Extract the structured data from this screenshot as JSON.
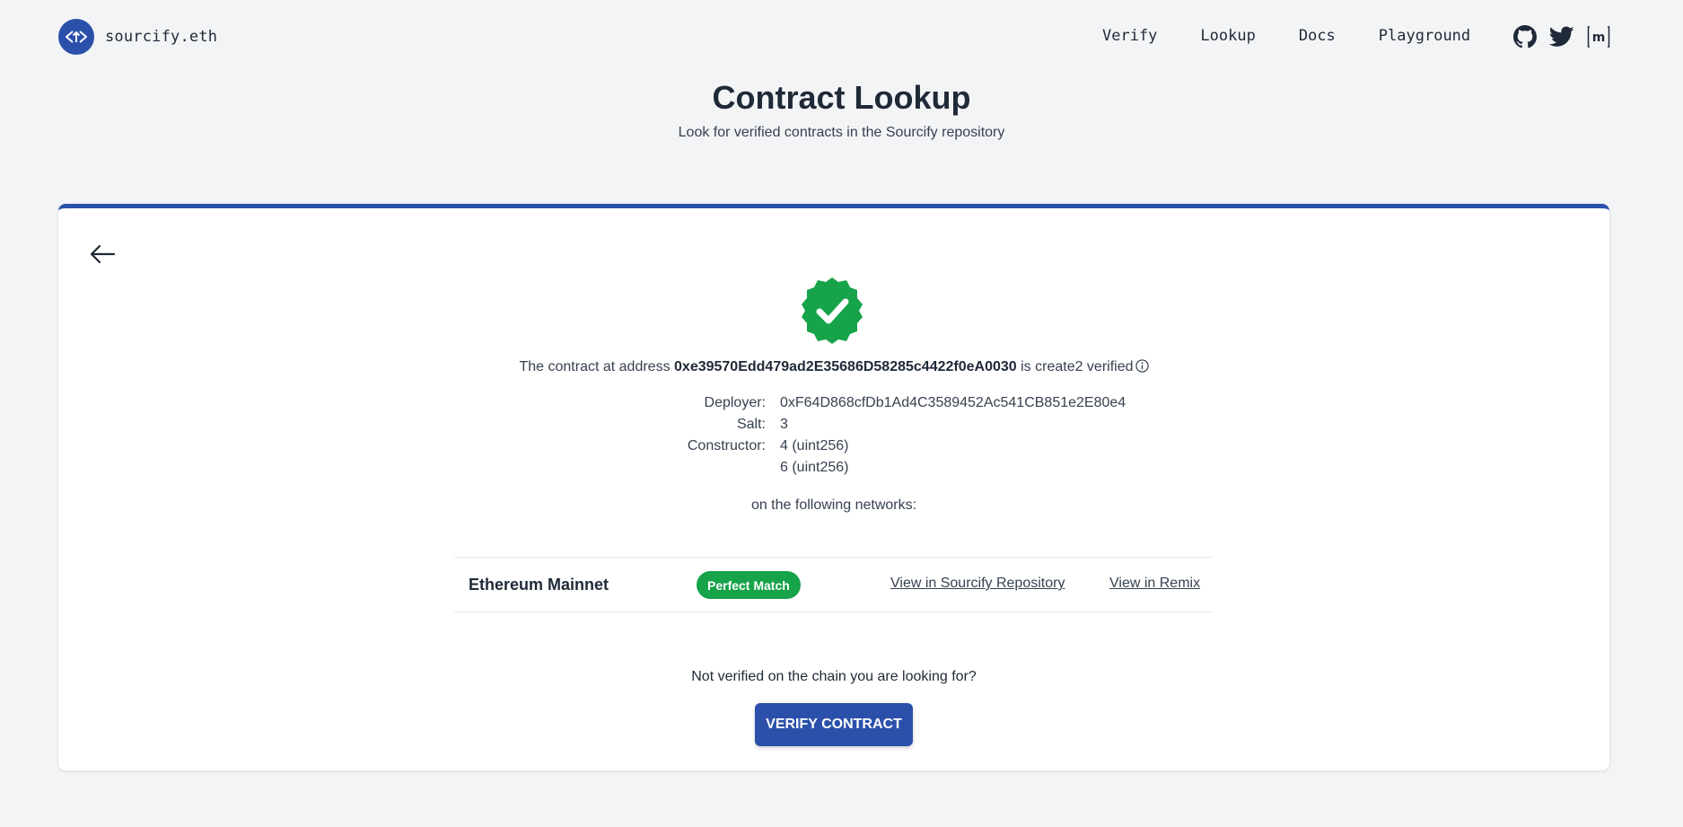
{
  "header": {
    "brand": "sourcify.eth",
    "nav": [
      "Verify",
      "Lookup",
      "Docs",
      "Playground"
    ],
    "social": [
      "github-icon",
      "twitter-icon",
      "matrix-icon"
    ],
    "matrix_label": "m"
  },
  "page": {
    "title": "Contract Lookup",
    "subtitle": "Look for verified contracts in the Sourcify repository"
  },
  "result": {
    "status_icon": "verified-badge-icon",
    "prefix": "The contract at address ",
    "address": "0xe39570Edd479ad2E35686D58285c4422f0eA0030",
    "suffix": " is create2 verified",
    "deployer_label": "Deployer:",
    "deployer": "0xF64D868cfDb1Ad4C3589452Ac541CB851e2E80e4",
    "salt_label": "Salt:",
    "salt": "3",
    "constructor_label": "Constructor:",
    "constructor_args": [
      "4 (uint256)",
      "6 (uint256)"
    ],
    "networks_intro": "on the following networks:"
  },
  "networks": [
    {
      "name": "Ethereum Mainnet",
      "match": "Perfect Match",
      "link_repo": "View in Sourcify Repository",
      "link_remix": "View in Remix"
    }
  ],
  "footer": {
    "question": "Not verified on the chain you are looking for?",
    "button": "VERIFY CONTRACT"
  },
  "colors": {
    "brand": "#2b50aa",
    "success": "#16a34a",
    "background": "#f3f4f6"
  }
}
